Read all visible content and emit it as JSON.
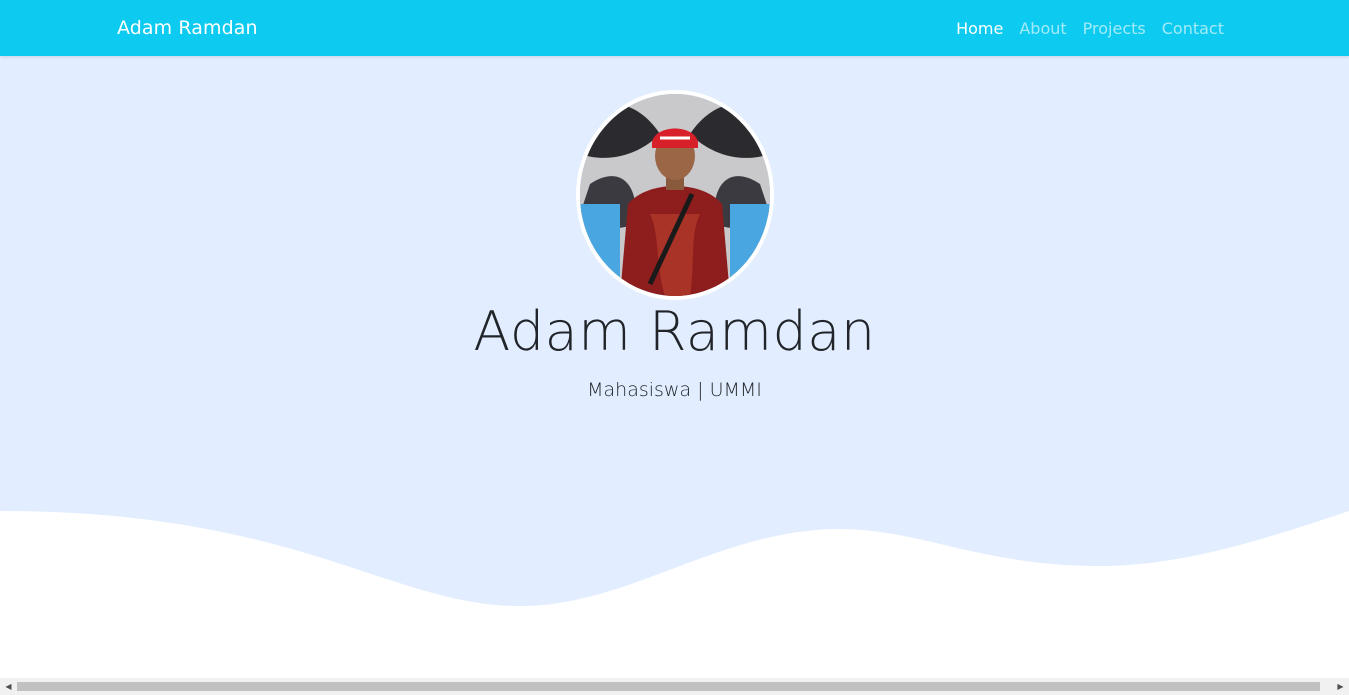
{
  "navbar": {
    "brand": "Adam Ramdan",
    "links": [
      {
        "label": "Home",
        "active": true
      },
      {
        "label": "About",
        "active": false
      },
      {
        "label": "Projects",
        "active": false
      },
      {
        "label": "Contact",
        "active": false
      }
    ],
    "color": "#0dcaf0"
  },
  "hero": {
    "name": "Adam Ramdan",
    "subtitle": "Mahasiswa | UMMI",
    "background": "#e2edff"
  },
  "scrollbar": {
    "left_icon": "triangle-left-icon",
    "right_icon": "triangle-right-icon"
  }
}
